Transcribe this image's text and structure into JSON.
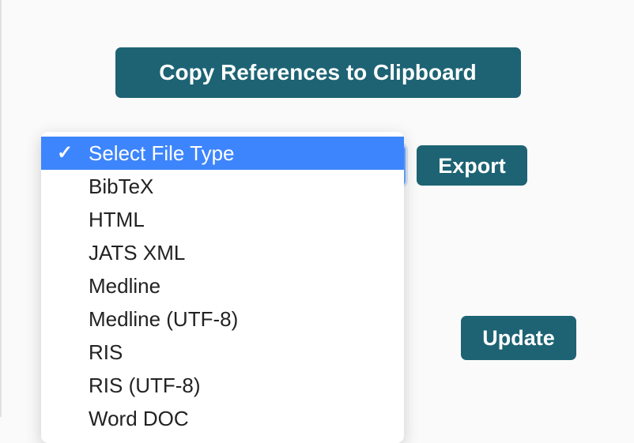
{
  "buttons": {
    "copy_label": "Copy References to Clipboard",
    "export_label": "Export",
    "update_label": "Update"
  },
  "filetype_select": {
    "placeholder": "Select File Type",
    "selected_index": 0,
    "options": [
      "Select File Type",
      "BibTeX",
      "HTML",
      "JATS XML",
      "Medline",
      "Medline (UTF-8)",
      "RIS",
      "RIS (UTF-8)",
      "Word DOC"
    ]
  },
  "colors": {
    "accent": "#1d6374",
    "dropdown_highlight": "#3d85fd",
    "focus_ring": "#6ea7ff"
  }
}
